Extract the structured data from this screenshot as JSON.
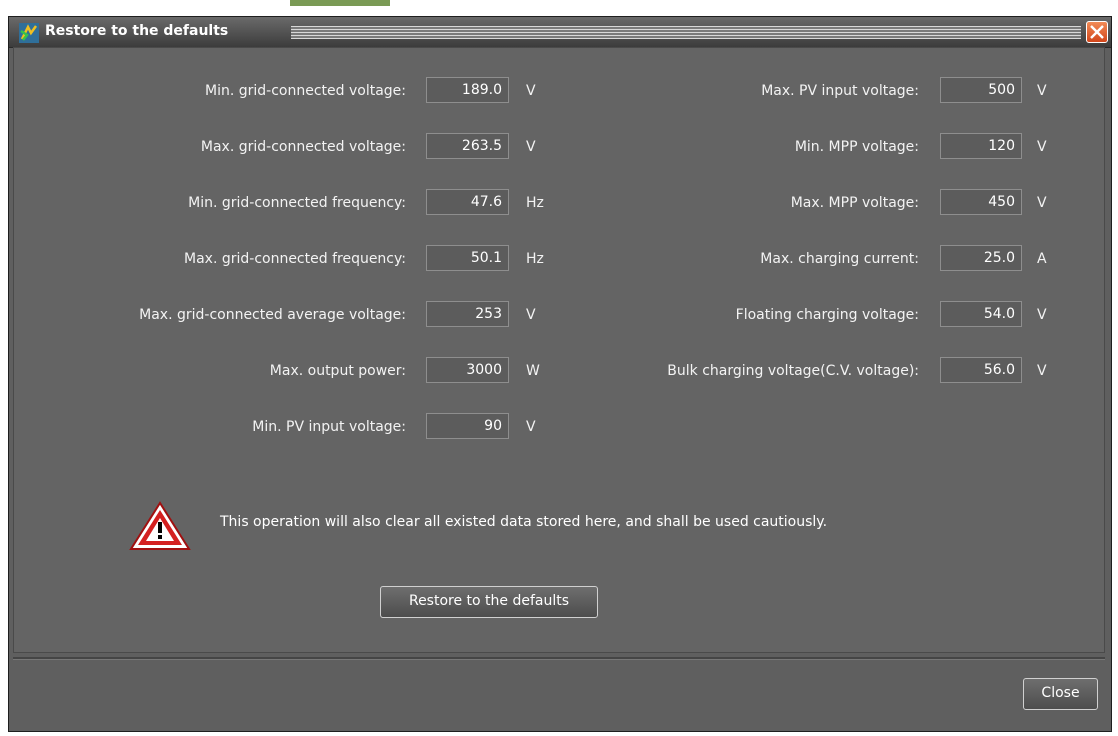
{
  "window": {
    "title": "Restore to the defaults"
  },
  "left_fields": [
    {
      "label": "Min. grid-connected voltage:",
      "value": "189.0",
      "unit": "V"
    },
    {
      "label": "Max. grid-connected voltage:",
      "value": "263.5",
      "unit": "V"
    },
    {
      "label": "Min. grid-connected frequency:",
      "value": "47.6",
      "unit": "Hz"
    },
    {
      "label": "Max. grid-connected frequency:",
      "value": "50.1",
      "unit": "Hz"
    },
    {
      "label": "Max. grid-connected average voltage:",
      "value": "253",
      "unit": "V"
    },
    {
      "label": "Max. output power:",
      "value": "3000",
      "unit": "W"
    },
    {
      "label": "Min. PV input voltage:",
      "value": "90",
      "unit": "V"
    }
  ],
  "right_fields": [
    {
      "label": "Max. PV input voltage:",
      "value": "500",
      "unit": "V"
    },
    {
      "label": "Min. MPP voltage:",
      "value": "120",
      "unit": "V"
    },
    {
      "label": "Max. MPP voltage:",
      "value": "450",
      "unit": "V"
    },
    {
      "label": "Max. charging current:",
      "value": "25.0",
      "unit": "A"
    },
    {
      "label": "Floating charging voltage:",
      "value": "54.0",
      "unit": "V"
    },
    {
      "label": "Bulk charging voltage(C.V. voltage):",
      "value": "56.0",
      "unit": "V"
    }
  ],
  "warning": {
    "text": "This operation will also clear all existed data stored here, and shall be used cautiously."
  },
  "buttons": {
    "restore_label": "Restore to the defaults",
    "close_label": "Close"
  },
  "icons": {
    "app": "solar-app-icon",
    "close": "close-icon",
    "warning": "warning-icon"
  },
  "colors": {
    "window_bg": "#646464",
    "close_button": "#e0602a",
    "warning_red": "#cc1f1f"
  }
}
